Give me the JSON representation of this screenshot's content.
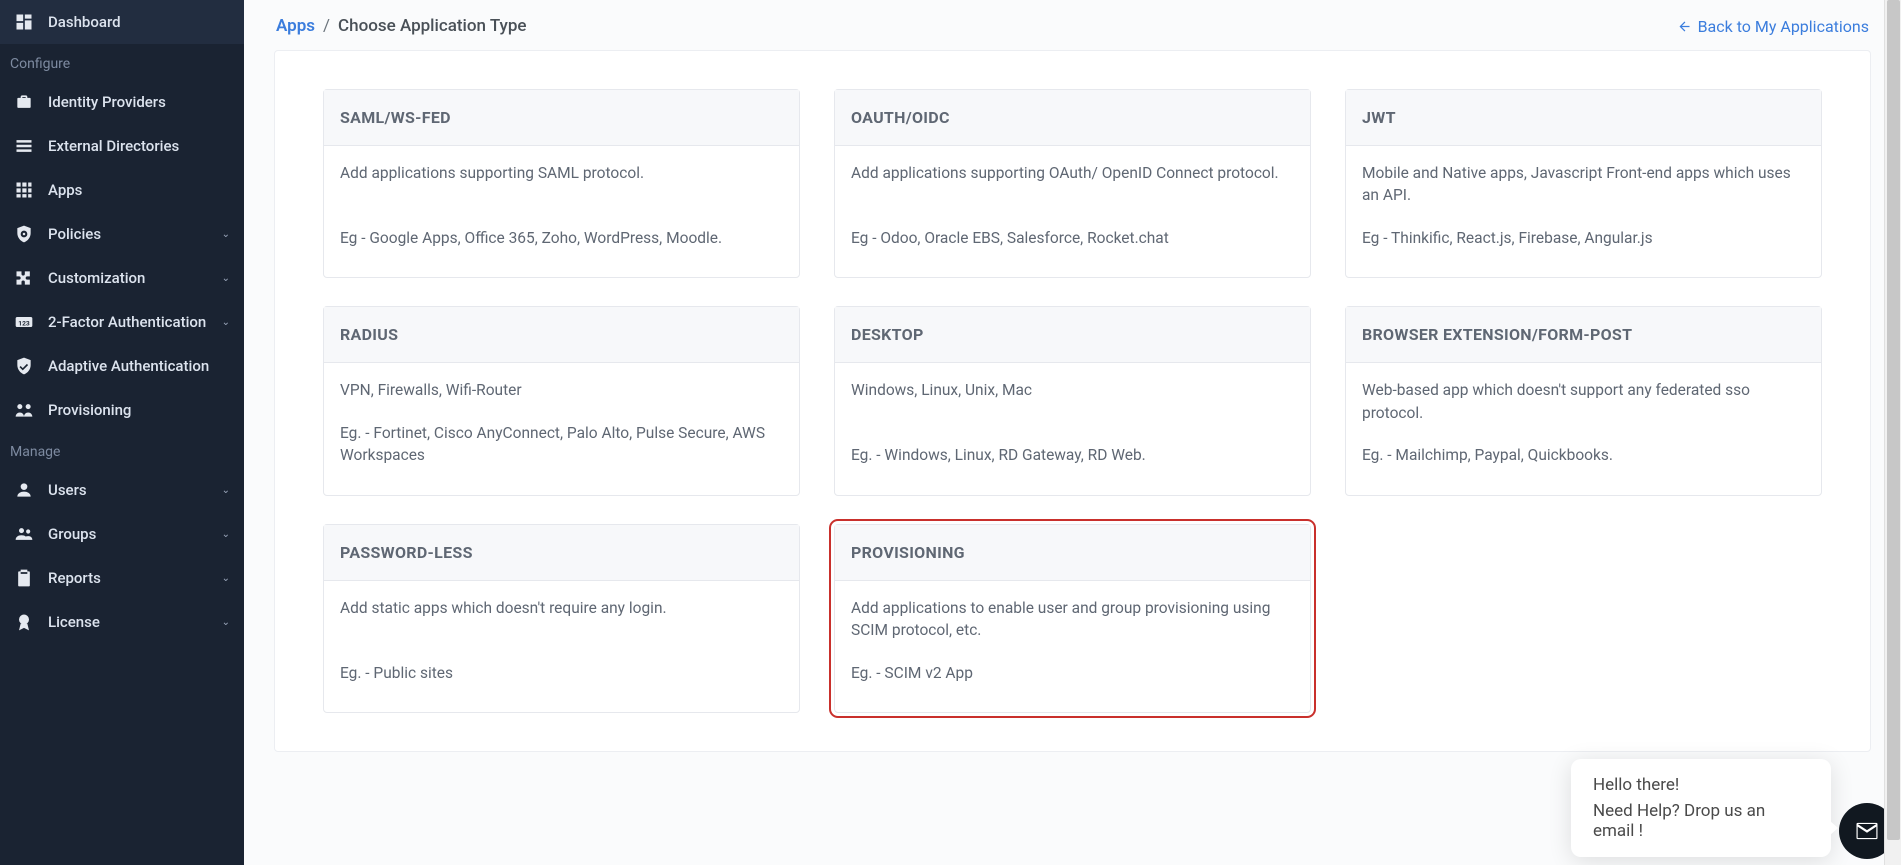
{
  "sidebar": {
    "items": [
      {
        "label": "Dashboard",
        "icon": "dashboard"
      }
    ],
    "sections": [
      {
        "title": "Configure",
        "items": [
          {
            "label": "Identity Providers",
            "icon": "briefcase",
            "exp": false
          },
          {
            "label": "External Directories",
            "icon": "list",
            "exp": false
          },
          {
            "label": "Apps",
            "icon": "grid",
            "exp": false
          },
          {
            "label": "Policies",
            "icon": "shield-cog",
            "exp": true
          },
          {
            "label": "Customization",
            "icon": "puzzle",
            "exp": true
          },
          {
            "label": "2-Factor Authentication",
            "icon": "123",
            "exp": true
          },
          {
            "label": "Adaptive Authentication",
            "icon": "shield-check",
            "exp": false
          },
          {
            "label": "Provisioning",
            "icon": "people-arrows",
            "exp": false
          }
        ]
      },
      {
        "title": "Manage",
        "items": [
          {
            "label": "Users",
            "icon": "user",
            "exp": true
          },
          {
            "label": "Groups",
            "icon": "group",
            "exp": true
          },
          {
            "label": "Reports",
            "icon": "clipboard",
            "exp": true
          },
          {
            "label": "License",
            "icon": "award",
            "exp": true
          }
        ]
      }
    ]
  },
  "breadcrumb": {
    "root": "Apps",
    "current": "Choose Application Type"
  },
  "backlink": "Back to My Applications",
  "cards": [
    {
      "title": "SAML/WS-FED",
      "desc": "Add applications supporting SAML protocol.",
      "eg": "Eg - Google Apps, Office 365, Zoho, WordPress, Moodle.",
      "highlight": false
    },
    {
      "title": "OAUTH/OIDC",
      "desc": "Add applications supporting OAuth/ OpenID Connect protocol.",
      "eg": "Eg - Odoo, Oracle EBS, Salesforce, Rocket.chat",
      "highlight": false
    },
    {
      "title": "JWT",
      "desc": "Mobile and Native apps, Javascript Front-end apps which uses an API.",
      "eg": "Eg - Thinkific, React.js, Firebase, Angular.js",
      "highlight": false
    },
    {
      "title": "RADIUS",
      "desc": "VPN, Firewalls, Wifi-Router",
      "eg": "Eg. - Fortinet, Cisco AnyConnect, Palo Alto, Pulse Secure, AWS Workspaces",
      "highlight": false
    },
    {
      "title": "DESKTOP",
      "desc": "Windows, Linux, Unix, Mac",
      "eg": "Eg. - Windows, Linux, RD Gateway, RD Web.",
      "highlight": false
    },
    {
      "title": "BROWSER EXTENSION/FORM-POST",
      "desc": "Web-based app which doesn't support any federated sso protocol.",
      "eg": "Eg. - Mailchimp, Paypal, Quickbooks.",
      "highlight": false
    },
    {
      "title": "PASSWORD-LESS",
      "desc": "Add static apps which doesn't require any login.",
      "eg": "Eg. - Public sites",
      "highlight": false
    },
    {
      "title": "PROVISIONING",
      "desc": "Add applications to enable user and group provisioning using SCIM protocol, etc.",
      "eg": "Eg. - SCIM v2 App",
      "highlight": true
    }
  ],
  "chat": {
    "line1": "Hello there!",
    "line2": "Need Help? Drop us an email !"
  }
}
